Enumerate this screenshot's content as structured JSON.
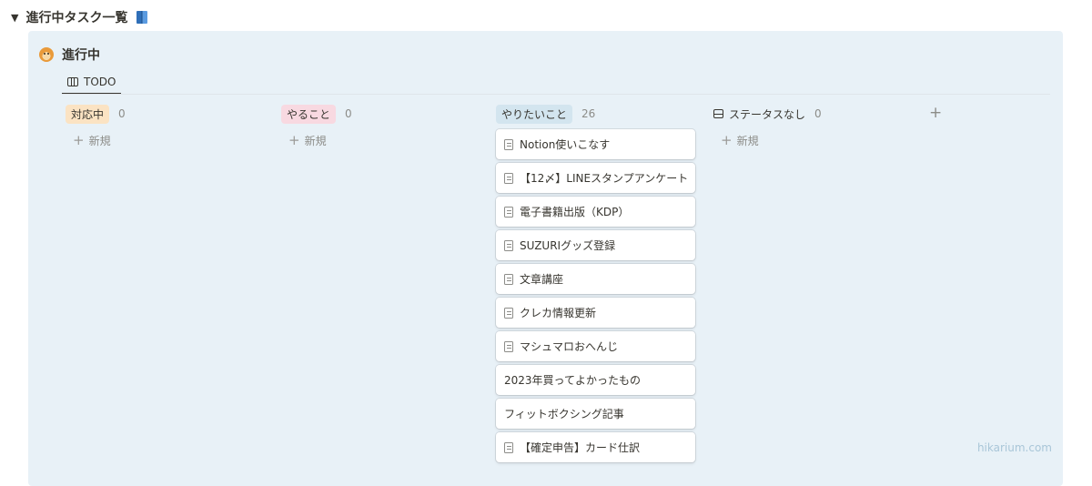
{
  "toggle": {
    "title": "進行中タスク一覧",
    "icon": "book-icon"
  },
  "callout": {
    "title": "進行中",
    "icon": "tiger-icon"
  },
  "view_tab": {
    "label": "TODO",
    "icon": "board-icon"
  },
  "columns": [
    {
      "name": "対応中",
      "count": "0",
      "pill_color": "#fbe3c3",
      "new_label": "新規"
    },
    {
      "name": "やること",
      "count": "0",
      "pill_color": "#f8d9e1",
      "new_label": "新規"
    },
    {
      "name": "やりたいこと",
      "count": "26",
      "pill_color": "#d3e5ef"
    },
    {
      "name": "ステータスなし",
      "count": "0",
      "icon": "inbox-icon",
      "new_label": "新規"
    }
  ],
  "add_group": "+",
  "cards": [
    {
      "title": "Notion使いこなす",
      "has_icon": true
    },
    {
      "title": "【12〆】LINEスタンプアンケート",
      "has_icon": true
    },
    {
      "title": "電子書籍出版（KDP）",
      "has_icon": true
    },
    {
      "title": "SUZURIグッズ登録",
      "has_icon": true
    },
    {
      "title": "文章講座",
      "has_icon": true
    },
    {
      "title": "クレカ情報更新",
      "has_icon": true
    },
    {
      "title": "マシュマロおへんじ",
      "has_icon": true
    },
    {
      "title": "2023年買ってよかったもの",
      "has_icon": false
    },
    {
      "title": "フィットボクシング記事",
      "has_icon": false
    },
    {
      "title": "【確定申告】カード仕訳",
      "has_icon": true
    }
  ],
  "watermark": "hikarium.com"
}
